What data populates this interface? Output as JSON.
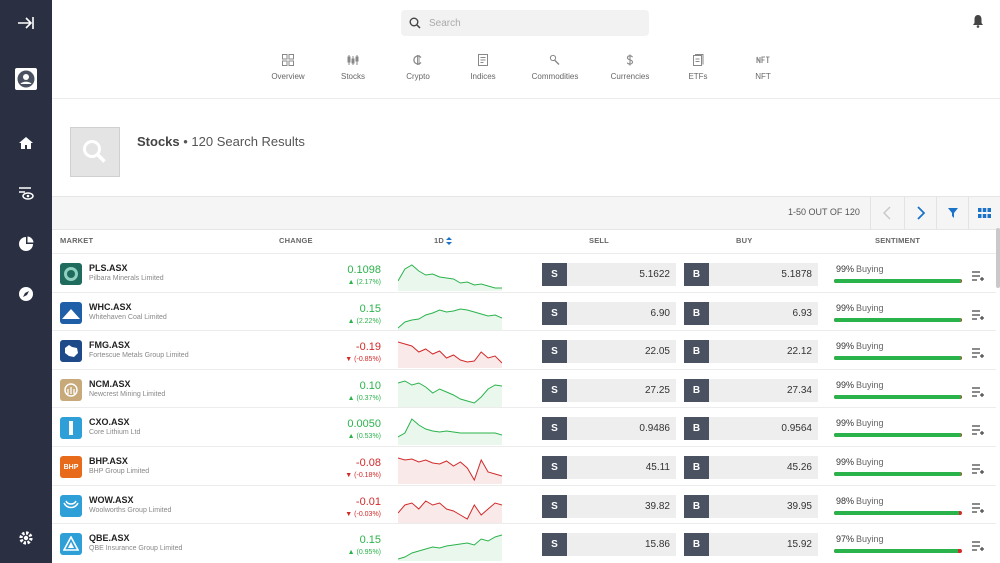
{
  "sidebar": {
    "icons": [
      "collapse-arrow-icon",
      "avatar-icon",
      "home-icon",
      "watchlist-icon",
      "portfolio-icon",
      "discover-icon",
      "settings-icon"
    ]
  },
  "header": {
    "search_placeholder": "Search",
    "categories": [
      {
        "label": "Overview",
        "icon": "grid-icon"
      },
      {
        "label": "Stocks",
        "icon": "candles-icon"
      },
      {
        "label": "Crypto",
        "icon": "crypto-icon"
      },
      {
        "label": "Indices",
        "icon": "indices-icon"
      },
      {
        "label": "Commodities",
        "icon": "commodities-icon"
      },
      {
        "label": "Currencies",
        "icon": "dollar-icon"
      },
      {
        "label": "ETFs",
        "icon": "etf-icon"
      },
      {
        "label": "NFT",
        "icon": "nft-icon"
      }
    ]
  },
  "results": {
    "title": "Stocks",
    "subtitle": "• 120 Search Results",
    "pager": "1-50 OUT OF 120"
  },
  "columns": {
    "market": "MARKET",
    "change": "CHANGE",
    "oneday": "1D",
    "sell": "SELL",
    "buy": "BUY",
    "sentiment": "SENTIMENT"
  },
  "trade_labels": {
    "sell": "S",
    "buy": "B"
  },
  "colors": {
    "up": "#2bb34b",
    "down": "#d12a2a",
    "sidebar": "#2a3042",
    "accent": "#1a73c8"
  },
  "rows": [
    {
      "ticker": "PLS.ASX",
      "name": "Pilbara Minerals Limited",
      "change": "0.1098",
      "pct": "▲ (2.17%)",
      "dir": "up",
      "sell": "5.1622",
      "buy": "5.1878",
      "sent_pct": "99%",
      "sent_word": "Buying",
      "sent_value": 99,
      "logo_text": "",
      "logo_color": "#1f6b5e",
      "spark": [
        20,
        8,
        4,
        10,
        14,
        13,
        16,
        17,
        18,
        22,
        21,
        24,
        23,
        25,
        27,
        27
      ]
    },
    {
      "ticker": "WHC.ASX",
      "name": "Whitehaven Coal Limited",
      "change": "0.15",
      "pct": "▲ (2.22%)",
      "dir": "up",
      "sell": "6.90",
      "buy": "6.93",
      "sent_pct": "99%",
      "sent_word": "Buying",
      "sent_value": 99,
      "logo_text": "",
      "logo_color": "#1e5fa8",
      "spark": [
        28,
        22,
        20,
        19,
        15,
        13,
        10,
        12,
        11,
        9,
        10,
        12,
        14,
        16,
        15,
        18
      ]
    },
    {
      "ticker": "FMG.ASX",
      "name": "Fortescue Metals Group Limited",
      "change": "-0.19",
      "pct": "▼ (-0.85%)",
      "dir": "down",
      "sell": "22.05",
      "buy": "22.12",
      "sent_pct": "99%",
      "sent_word": "Buying",
      "sent_value": 99,
      "logo_text": "",
      "logo_color": "#1e4a8a",
      "spark": [
        4,
        6,
        8,
        14,
        11,
        16,
        13,
        20,
        17,
        22,
        24,
        23,
        14,
        20,
        18,
        25
      ]
    },
    {
      "ticker": "NCM.ASX",
      "name": "Newcrest Mining Limited",
      "change": "0.10",
      "pct": "▲ (0.37%)",
      "dir": "up",
      "sell": "27.25",
      "buy": "27.34",
      "sent_pct": "99%",
      "sent_word": "Buying",
      "sent_value": 99,
      "logo_text": "",
      "logo_color": "#c7a97a",
      "spark": [
        6,
        4,
        8,
        6,
        10,
        16,
        12,
        15,
        18,
        22,
        24,
        26,
        20,
        12,
        8,
        9
      ]
    },
    {
      "ticker": "CXO.ASX",
      "name": "Core Lithium Ltd",
      "change": "0.0050",
      "pct": "▲ (0.53%)",
      "dir": "up",
      "sell": "0.9486",
      "buy": "0.9564",
      "sent_pct": "99%",
      "sent_word": "Buying",
      "sent_value": 99,
      "logo_text": "",
      "logo_color": "#2f9fd8",
      "spark": [
        22,
        18,
        4,
        10,
        14,
        16,
        17,
        16,
        17,
        18,
        18,
        18,
        18,
        18,
        18,
        20
      ]
    },
    {
      "ticker": "BHP.ASX",
      "name": "BHP Group Limited",
      "change": "-0.08",
      "pct": "▼ (-0.18%)",
      "dir": "down",
      "sell": "45.11",
      "buy": "45.26",
      "sent_pct": "99%",
      "sent_word": "Buying",
      "sent_value": 99,
      "logo_text": "BHP",
      "logo_color": "#e86b1c",
      "spark": [
        4,
        6,
        5,
        8,
        6,
        9,
        10,
        7,
        12,
        8,
        14,
        26,
        6,
        18,
        20,
        22
      ]
    },
    {
      "ticker": "WOW.ASX",
      "name": "Woolworths Group Limited",
      "change": "-0.01",
      "pct": "▼ (-0.03%)",
      "dir": "down",
      "sell": "39.82",
      "buy": "39.95",
      "sent_pct": "98%",
      "sent_word": "Buying",
      "sent_value": 98,
      "logo_text": "",
      "logo_color": "#2f9fd8",
      "spark": [
        20,
        12,
        10,
        16,
        8,
        12,
        10,
        16,
        18,
        22,
        26,
        12,
        22,
        16,
        10,
        12
      ]
    },
    {
      "ticker": "QBE.ASX",
      "name": "QBE Insurance Group Limited",
      "change": "0.15",
      "pct": "▲ (0.95%)",
      "dir": "up",
      "sell": "15.86",
      "buy": "15.92",
      "sent_pct": "97%",
      "sent_word": "Buying",
      "sent_value": 97,
      "logo_text": "",
      "logo_color": "#2f9fd8",
      "spark": [
        28,
        26,
        22,
        20,
        18,
        16,
        17,
        15,
        14,
        13,
        12,
        14,
        8,
        10,
        6,
        4
      ]
    }
  ]
}
